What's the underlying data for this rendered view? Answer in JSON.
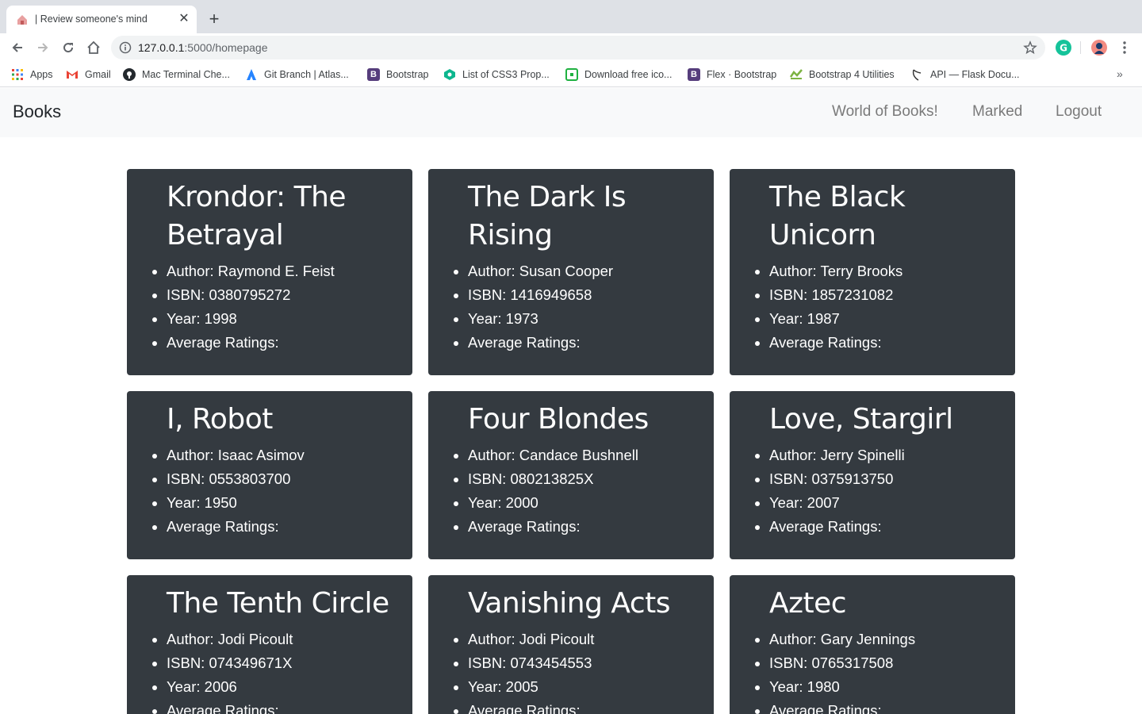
{
  "browser": {
    "tab_title": "| Review someone's mind",
    "url_host": "127.0.0.1",
    "url_path": ":5000/homepage",
    "bookmarks": [
      {
        "label": "Apps",
        "icon": "apps-grid-icon"
      },
      {
        "label": "Gmail",
        "icon": "gmail-icon"
      },
      {
        "label": "Mac Terminal Che...",
        "icon": "github-icon"
      },
      {
        "label": "Git Branch | Atlas...",
        "icon": "atlassian-icon"
      },
      {
        "label": "Bootstrap",
        "icon": "bootstrap-icon"
      },
      {
        "label": "List of CSS3 Prop...",
        "icon": "css3-list-icon"
      },
      {
        "label": "Download free ico...",
        "icon": "icon-download-icon"
      },
      {
        "label": "Flex · Bootstrap",
        "icon": "bootstrap-icon"
      },
      {
        "label": "Bootstrap 4 Utilities",
        "icon": "bootstrap-utilities-icon"
      },
      {
        "label": "API — Flask Docu...",
        "icon": "flask-icon"
      }
    ],
    "colors": {
      "tabstrip": "#dee1e6",
      "omnibox": "#f1f3f4",
      "bootstrap_purple": "#563d7c"
    }
  },
  "navbar": {
    "brand": "Books",
    "links": [
      "World of Books!",
      "Marked",
      "Logout"
    ]
  },
  "field_labels": {
    "author": "Author: ",
    "isbn": "ISBN: ",
    "year": "Year: ",
    "ratings": "Average Ratings:"
  },
  "books": [
    {
      "title": "Krondor: The Betrayal",
      "author": "Raymond E. Feist",
      "isbn": "0380795272",
      "year": "1998"
    },
    {
      "title": "The Dark Is Rising",
      "author": "Susan Cooper",
      "isbn": "1416949658",
      "year": "1973"
    },
    {
      "title": "The Black Unicorn",
      "author": "Terry Brooks",
      "isbn": "1857231082",
      "year": "1987"
    },
    {
      "title": "I, Robot",
      "author": "Isaac Asimov",
      "isbn": "0553803700",
      "year": "1950"
    },
    {
      "title": "Four Blondes",
      "author": "Candace Bushnell",
      "isbn": "080213825X",
      "year": "2000"
    },
    {
      "title": "Love, Stargirl",
      "author": "Jerry Spinelli",
      "isbn": "0375913750",
      "year": "2007"
    },
    {
      "title": "The Tenth Circle",
      "author": "Jodi Picoult",
      "isbn": "074349671X",
      "year": "2006"
    },
    {
      "title": "Vanishing Acts",
      "author": "Jodi Picoult",
      "isbn": "0743454553",
      "year": "2005"
    },
    {
      "title": "Aztec",
      "author": "Gary Jennings",
      "isbn": "0765317508",
      "year": "1980"
    }
  ],
  "colors": {
    "card_bg": "#343a40",
    "card_text": "#ffffff",
    "navbar_bg": "#f8f9fa",
    "nav_link": "#7a7a7a"
  }
}
